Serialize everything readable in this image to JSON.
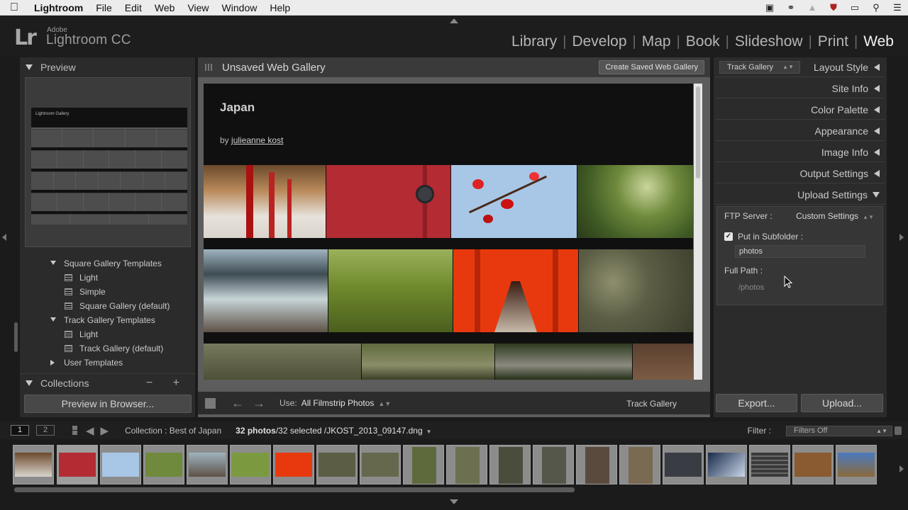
{
  "menubar": {
    "app": "Lightroom",
    "items": [
      "File",
      "Edit",
      "Web",
      "View",
      "Window",
      "Help"
    ],
    "status_icons": [
      "camera-icon",
      "creative-cloud-icon",
      "upload-icon",
      "shield-icon",
      "display-icon",
      "search-icon",
      "list-icon"
    ]
  },
  "app": {
    "logo": "Lr",
    "brand_top": "Adobe",
    "brand_name": "Lightroom CC"
  },
  "modules": [
    "Library",
    "Develop",
    "Map",
    "Book",
    "Slideshow",
    "Print",
    "Web"
  ],
  "active_module": "Web",
  "left": {
    "preview_title": "Preview",
    "mini_gallery_title": "Lightroom Gallery",
    "tree": [
      {
        "type": "folder",
        "label": "Square Gallery Templates",
        "expanded": true
      },
      {
        "type": "item",
        "label": "Light"
      },
      {
        "type": "item",
        "label": "Simple"
      },
      {
        "type": "item",
        "label": "Square Gallery (default)"
      },
      {
        "type": "folder",
        "label": "Track Gallery Templates",
        "expanded": true
      },
      {
        "type": "item",
        "label": "Light"
      },
      {
        "type": "item",
        "label": "Track Gallery (default)"
      },
      {
        "type": "folder",
        "label": "User Templates",
        "expanded": false
      }
    ],
    "collections_title": "Collections",
    "collections_ctrl": "− +",
    "preview_button": "Preview in Browser..."
  },
  "center": {
    "title": "Unsaved Web Gallery",
    "save_button": "Create Saved Web Gallery",
    "gallery_title": "Japan",
    "gallery_by": "by",
    "gallery_author": "julieanne kost",
    "use_label": "Use:",
    "use_value": "All Filmstrip Photos",
    "layout_name": "Track Gallery"
  },
  "right": {
    "track_select": "Track Gallery",
    "sections": [
      "Layout Style",
      "Site Info",
      "Color Palette",
      "Appearance",
      "Image Info",
      "Output Settings",
      "Upload Settings"
    ],
    "ftp_label": "FTP Server :",
    "ftp_value": "Custom Settings",
    "subfolder_checked": true,
    "subfolder_label": "Put in Subfolder :",
    "subfolder_value": "photos",
    "fullpath_label": "Full Path :",
    "fullpath_value": "/photos",
    "export_button": "Export...",
    "upload_button": "Upload..."
  },
  "filmstrip_bar": {
    "view1": "1",
    "view2": "2",
    "collection": "Collection : Best of Japan",
    "count": "32 photos",
    "selected": "/32 selected /JKOST_2013_09147.dng",
    "filter_label": "Filter :",
    "filter_value": "Filters Off"
  },
  "colors": {
    "accent_active": "#f2f2f2",
    "panel_bg": "#2b2b2b"
  }
}
